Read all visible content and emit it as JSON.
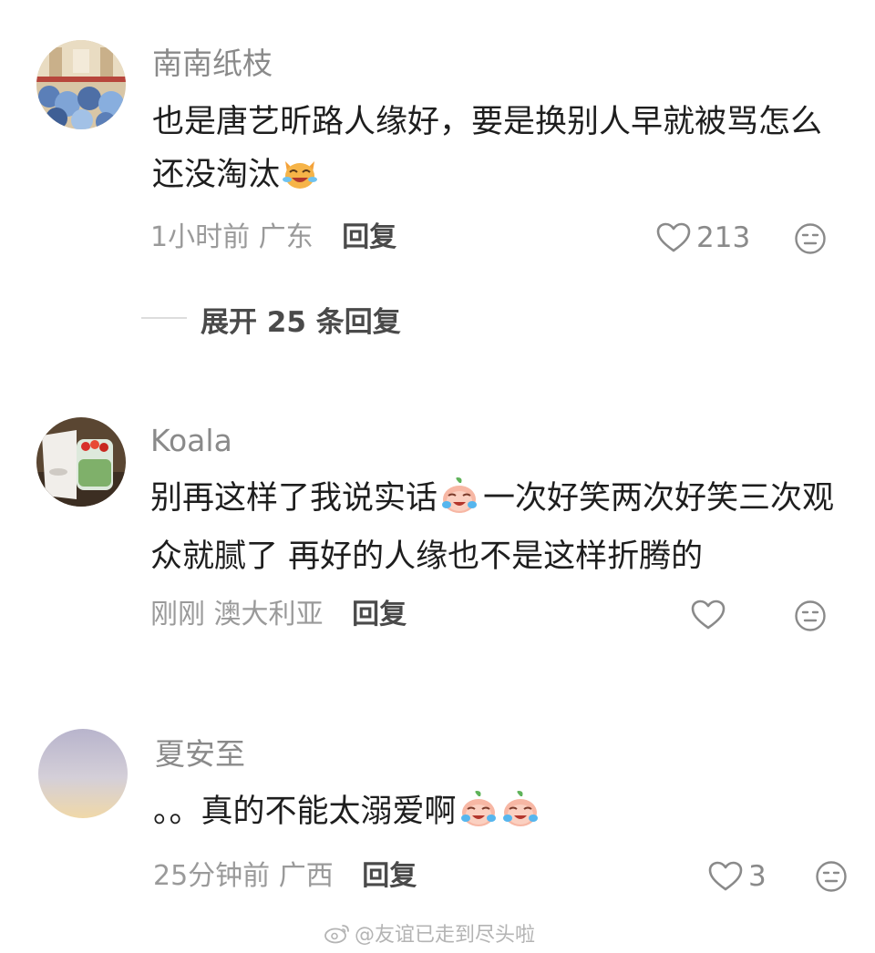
{
  "comments": [
    {
      "username": "南南纸枝",
      "text": "也是唐艺昕路人缘好，要是换别人早就被骂怎么还没淘汰",
      "emoji": "laughing-crying-cat-emoji",
      "time": "1小时前",
      "location": "广东",
      "reply_label": "回复",
      "likes": "213",
      "expand_label": "展开 25 条回复"
    },
    {
      "username": "Koala",
      "text_parts": [
        "别再这样了我说实话",
        "一次好笑两次好笑三次观众就腻了 再好的人缘也不是这样折腾的"
      ],
      "emoji": "crying-peach-emoji",
      "time": "刚刚",
      "location": "澳大利亚",
      "reply_label": "回复",
      "likes": ""
    },
    {
      "username": "夏安至",
      "text": "。。真的不能太溺爱啊",
      "emoji": "crying-peach-emoji",
      "time": "25分钟前",
      "location": "广西",
      "reply_label": "回复",
      "likes": "3"
    }
  ],
  "watermark": "@友谊已走到尽头啦",
  "colors": {
    "username": "#8a8a8a",
    "text": "#1e1e1e",
    "meta": "#9a9a9a",
    "reply": "#4a4a4a",
    "background": "#ffffff"
  }
}
